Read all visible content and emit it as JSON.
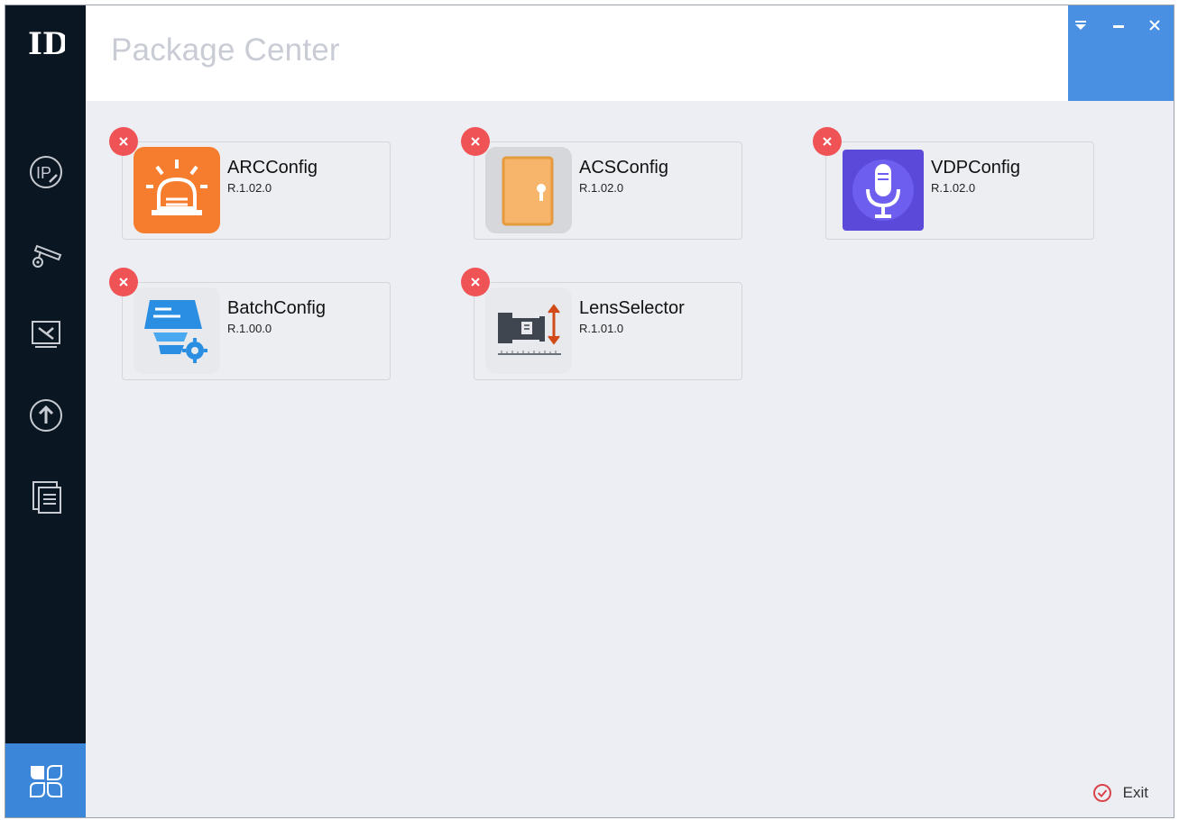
{
  "header": {
    "title": "Package Center"
  },
  "window_controls": {
    "menu_icon": "dropdown-triangle-icon",
    "minimize_icon": "minimize-icon",
    "close_icon": "close-icon"
  },
  "sidebar": {
    "items": [
      {
        "name": "ip-config",
        "icon": "ip-modify-icon"
      },
      {
        "name": "device-config",
        "icon": "camera-settings-icon"
      },
      {
        "name": "system-maintenance",
        "icon": "maintenance-tools-icon"
      },
      {
        "name": "upgrade",
        "icon": "upgrade-icon"
      },
      {
        "name": "documents",
        "icon": "documents-icon"
      }
    ],
    "active": {
      "name": "package-center",
      "icon": "apps-grid-icon"
    }
  },
  "packages": [
    {
      "name": "ARCConfig",
      "version": "R.1.02.0",
      "icon": "alarm-light-icon"
    },
    {
      "name": "ACSConfig",
      "version": "R.1.02.0",
      "icon": "door-lock-icon"
    },
    {
      "name": "VDPConfig",
      "version": "R.1.02.0",
      "icon": "microphone-icon"
    },
    {
      "name": "BatchConfig",
      "version": "R.1.00.0",
      "icon": "batch-config-icon"
    },
    {
      "name": "LensSelector",
      "version": "R.1.01.0",
      "icon": "lens-selector-icon"
    }
  ],
  "footer": {
    "exit_label": "Exit"
  },
  "colors": {
    "sidebar": "#0a1622",
    "accent": "#4a90e2",
    "remove": "#f05356",
    "background": "#edeef3"
  }
}
